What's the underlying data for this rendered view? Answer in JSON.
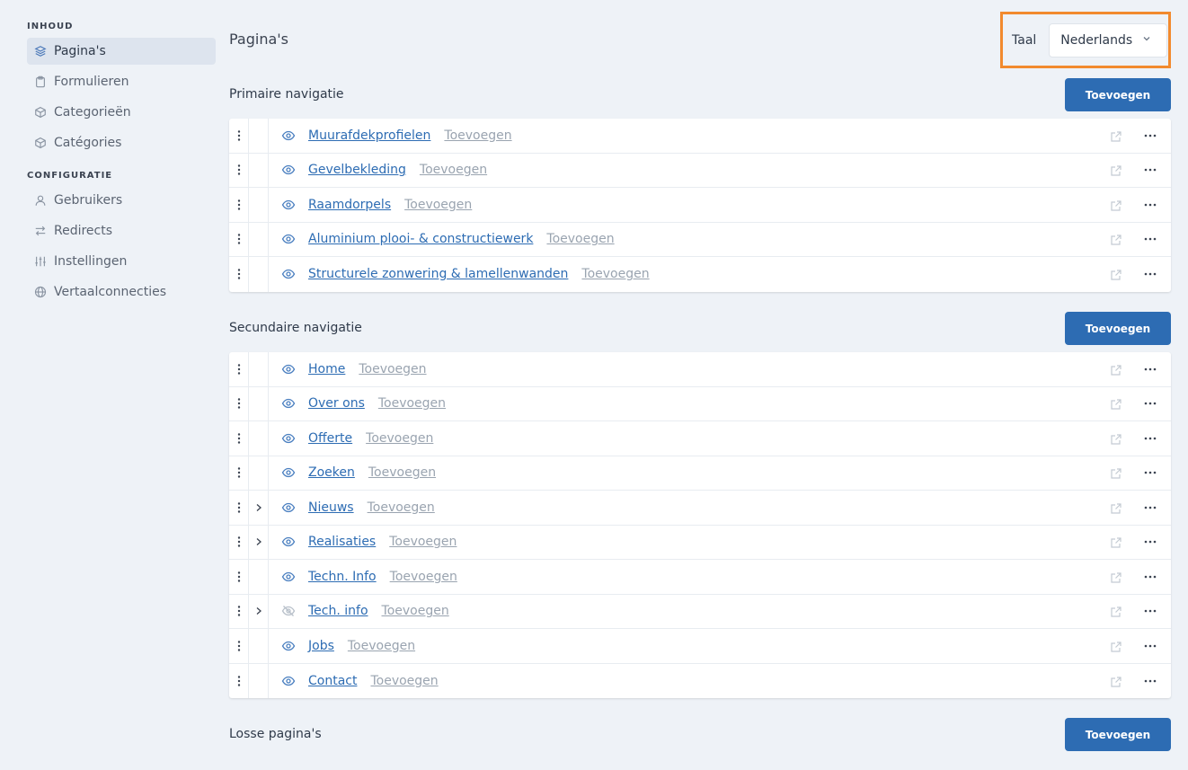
{
  "sidebar": {
    "sections": [
      {
        "title": "INHOUD",
        "items": [
          {
            "label": "Pagina's",
            "icon": "layers-icon",
            "active": true
          },
          {
            "label": "Formulieren",
            "icon": "clipboard-icon",
            "active": false
          },
          {
            "label": "Categorieën",
            "icon": "cube-icon",
            "active": false
          },
          {
            "label": "Catégories",
            "icon": "cube-icon",
            "active": false
          }
        ]
      },
      {
        "title": "CONFIGURATIE",
        "items": [
          {
            "label": "Gebruikers",
            "icon": "user-icon",
            "active": false
          },
          {
            "label": "Redirects",
            "icon": "arrows-icon",
            "active": false
          },
          {
            "label": "Instellingen",
            "icon": "sliders-icon",
            "active": false
          },
          {
            "label": "Vertaalconnecties",
            "icon": "globe-icon",
            "active": false
          }
        ]
      }
    ]
  },
  "header": {
    "title": "Pagina's",
    "language_label": "Taal",
    "language_value": "Nederlands"
  },
  "sections": [
    {
      "title": "Primaire navigatie",
      "add_label": "Toevoegen",
      "pages": [
        {
          "label": "Muurafdekprofielen",
          "add_label": "Toevoegen",
          "visible": true,
          "expandable": false
        },
        {
          "label": "Gevelbekleding",
          "add_label": "Toevoegen",
          "visible": true,
          "expandable": false
        },
        {
          "label": "Raamdorpels",
          "add_label": "Toevoegen",
          "visible": true,
          "expandable": false
        },
        {
          "label": "Aluminium plooi- & constructiewerk",
          "add_label": "Toevoegen",
          "visible": true,
          "expandable": false
        },
        {
          "label": "Structurele zonwering & lamellenwanden",
          "add_label": "Toevoegen",
          "visible": true,
          "expandable": false
        }
      ]
    },
    {
      "title": "Secundaire navigatie",
      "add_label": "Toevoegen",
      "pages": [
        {
          "label": "Home",
          "add_label": "Toevoegen",
          "visible": true,
          "expandable": false
        },
        {
          "label": "Over ons",
          "add_label": "Toevoegen",
          "visible": true,
          "expandable": false
        },
        {
          "label": "Offerte",
          "add_label": "Toevoegen",
          "visible": true,
          "expandable": false
        },
        {
          "label": "Zoeken",
          "add_label": "Toevoegen",
          "visible": true,
          "expandable": false
        },
        {
          "label": "Nieuws",
          "add_label": "Toevoegen",
          "visible": true,
          "expandable": true
        },
        {
          "label": "Realisaties",
          "add_label": "Toevoegen",
          "visible": true,
          "expandable": true
        },
        {
          "label": "Techn. Info",
          "add_label": "Toevoegen",
          "visible": true,
          "expandable": false
        },
        {
          "label": "Tech. info",
          "add_label": "Toevoegen",
          "visible": false,
          "expandable": true
        },
        {
          "label": "Jobs",
          "add_label": "Toevoegen",
          "visible": true,
          "expandable": false
        },
        {
          "label": "Contact",
          "add_label": "Toevoegen",
          "visible": true,
          "expandable": false
        }
      ]
    },
    {
      "title": "Losse pagina's",
      "add_label": "Toevoegen",
      "pages": []
    }
  ],
  "colors": {
    "accent": "#2d6cb3",
    "highlight_border": "#f28a2e",
    "background": "#eef2f7"
  }
}
